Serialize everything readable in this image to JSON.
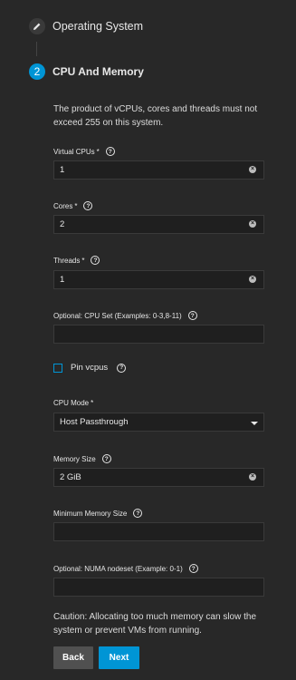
{
  "steps": [
    {
      "label": "Operating System",
      "icon": "pencil-icon"
    },
    {
      "number": "2",
      "label": "CPU And Memory"
    }
  ],
  "cpu_note": "The product of vCPUs, cores and threads must not exceed 255 on this system.",
  "fields": {
    "vcpus": {
      "label": "Virtual CPUs",
      "required": "*",
      "value": "1"
    },
    "cores": {
      "label": "Cores",
      "required": "*",
      "value": "2"
    },
    "threads": {
      "label": "Threads",
      "required": "*",
      "value": "1"
    },
    "cpu_set": {
      "label": "Optional: CPU Set (Examples: 0-3,8-11)",
      "value": ""
    },
    "pin_vcpus": {
      "label": "Pin vcpus",
      "checked": false
    },
    "cpu_mode": {
      "label": "CPU Mode",
      "required": "*",
      "value": "Host Passthrough"
    },
    "memory_size": {
      "label": "Memory Size",
      "value": "2 GiB"
    },
    "min_memory_size": {
      "label": "Minimum Memory Size",
      "value": ""
    },
    "numa_nodeset": {
      "label": "Optional: NUMA nodeset (Example: 0-1)",
      "value": ""
    }
  },
  "memory_note": "Caution: Allocating too much memory can slow the system or prevent VMs from running.",
  "buttons": {
    "back": "Back",
    "next": "Next"
  },
  "colors": {
    "accent": "#0095d5",
    "background": "#282828",
    "field": "#1f1f1f"
  }
}
